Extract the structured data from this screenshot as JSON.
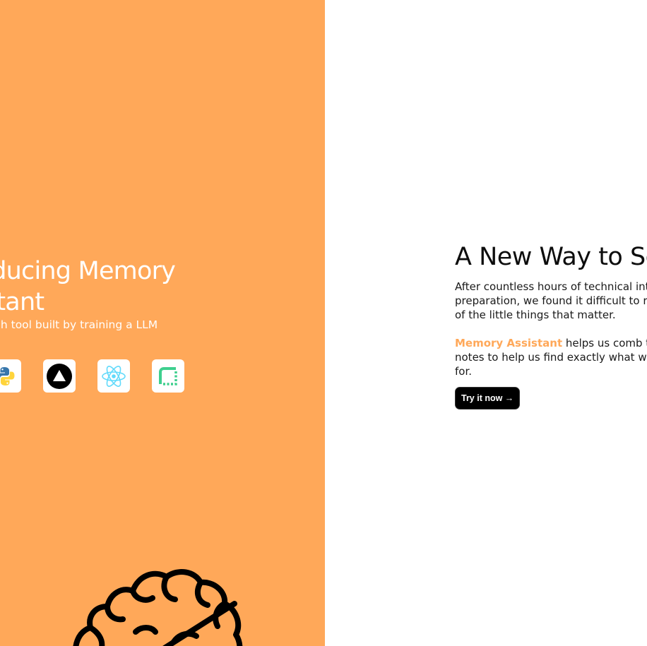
{
  "hero": {
    "title": "Introducing Memory\nAssistant",
    "subtitle": "A personalized search tool built by training a LLM\non our notes.",
    "background_color": "#FFA859",
    "tech_icons": [
      "python-icon",
      "vercel-icon",
      "react-icon",
      "supabase-icon"
    ],
    "illustration": "brain-icon"
  },
  "content": {
    "heading": "A New Way to Search",
    "paragraph1": "After countless hours of technical interview\npreparation, we found it difficult to remember all\nof the little things that matter.",
    "brand_name": "Memory Assistant",
    "paragraph2_rest": " helps us comb through our\nnotes to help us find exactly what we're looking\nfor.",
    "cta_label": "Try it now →"
  }
}
